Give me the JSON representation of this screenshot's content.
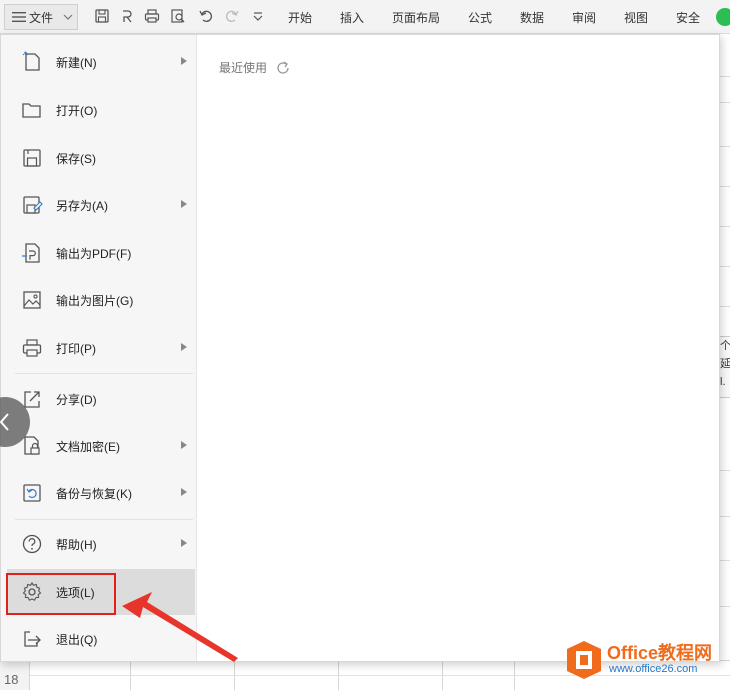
{
  "toolbar": {
    "file_label": "文件",
    "tabs": [
      "开始",
      "插入",
      "页面布局",
      "公式",
      "数据",
      "审阅",
      "视图",
      "安全"
    ]
  },
  "menu": {
    "items": [
      {
        "label": "新建(N)",
        "icon": "new-file-icon",
        "has_submenu": true
      },
      {
        "label": "打开(O)",
        "icon": "folder-icon",
        "has_submenu": false
      },
      {
        "label": "保存(S)",
        "icon": "save-icon",
        "has_submenu": false
      },
      {
        "label": "另存为(A)",
        "icon": "save-as-icon",
        "has_submenu": true
      },
      {
        "label": "输出为PDF(F)",
        "icon": "pdf-export-icon",
        "has_submenu": false
      },
      {
        "label": "输出为图片(G)",
        "icon": "image-export-icon",
        "has_submenu": false
      },
      {
        "label": "打印(P)",
        "icon": "printer-icon",
        "has_submenu": true
      },
      {
        "label": "分享(D)",
        "icon": "share-icon",
        "has_submenu": false
      },
      {
        "label": "文档加密(E)",
        "icon": "encrypt-icon",
        "has_submenu": true
      },
      {
        "label": "备份与恢复(K)",
        "icon": "backup-icon",
        "has_submenu": true
      },
      {
        "label": "帮助(H)",
        "icon": "help-icon",
        "has_submenu": true
      },
      {
        "label": "选项(L)",
        "icon": "gear-icon",
        "has_submenu": false,
        "selected": true
      },
      {
        "label": "退出(Q)",
        "icon": "exit-icon",
        "has_submenu": false
      }
    ]
  },
  "recent": {
    "label": "最近使用"
  },
  "sheet": {
    "row_number": "18",
    "right_stub_lines": [
      "个",
      "延",
      "l."
    ]
  },
  "watermark": {
    "title": "Office教程网",
    "url": "www.office26.com"
  },
  "colors": {
    "highlight": "#e0201a",
    "arrow": "#e8352b",
    "accent_green": "#2dbd55",
    "watermark_orange": "#f06b1c"
  }
}
